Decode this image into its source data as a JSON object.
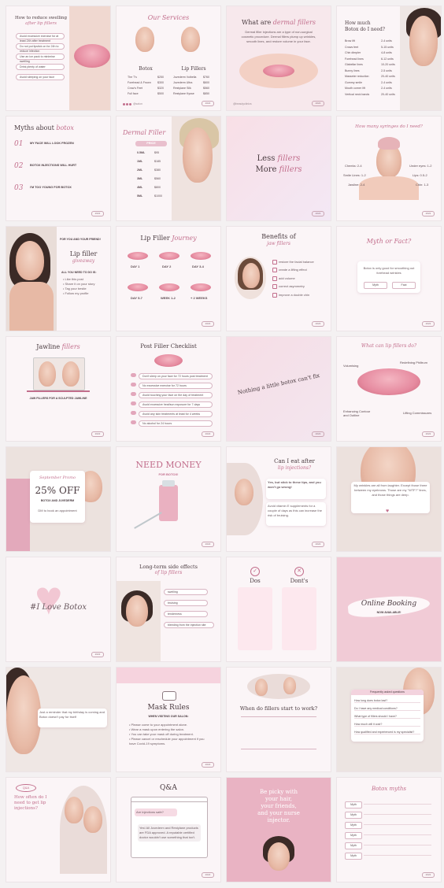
{
  "tiles": {
    "t1": {
      "title": "How to reduce swelling",
      "subtitle": "after lip fillers",
      "items": [
        "Avoid excessive exercise for at least 24h after treatment",
        "Do not put lipstick on for 24h to reduce infection",
        "Use an ice pack to minimise swelling",
        "Drink plenty of water",
        "Avoid sleeping on your face"
      ]
    },
    "t2": {
      "title": "Our Services",
      "col1": "Botox",
      "col2": "Lip Fillers",
      "rows1": [
        "The T's",
        "Forehead & Frown",
        "Crow's Feet",
        "Full face"
      ],
      "prices1": [
        "$250",
        "$300",
        "$320",
        "$500"
      ],
      "rows2": [
        "Juvederm Volbella",
        "Juvederm Ultra",
        "Restylane Silk",
        "Restylane Kysse"
      ],
      "prices2": [
        "$760",
        "$600",
        "$560",
        "$850"
      ]
    },
    "t3": {
      "title": "What are",
      "script": "dermal fillers",
      "body": "Dermal filler injections are a type of non-surgical cosmetic procedure. Dermal fillers plump up wrinkles, smooth lines, and restore volume in your face.",
      "handle": "@beautyclinics"
    },
    "t4": {
      "title": "How much",
      "title2": "Botox do I need?",
      "rows": [
        "Brow lift",
        "Crows feet",
        "Chin dimpler",
        "Forehead lines",
        "Glabellar lines",
        "Bunny lines",
        "Masseter reduction",
        "Gummy smile",
        "Mouth corner lift",
        "Vertical neck bands"
      ],
      "units": [
        "2-4 units",
        "5-15 units",
        "4-8 units",
        "6-12 units",
        "10-20 units",
        "2-5 units",
        "20-40 units",
        "2-4 units",
        "2-4 units",
        "20-40 units"
      ]
    },
    "t5": {
      "title": "Myths about",
      "script": "botox",
      "myths": [
        "MY FACE WILL LOOK FROZEN",
        "BOTOX INJECTIONS WILL HURT",
        "I'M TOO YOUNG FOR BOTOX"
      ],
      "nums": [
        "01",
        "02",
        "03"
      ]
    },
    "t6": {
      "title": "Dermal Filler",
      "price_label": "PRICE",
      "sizes": [
        "0.5ML",
        "1ML",
        "2ML",
        "3ML",
        "4ML",
        "5ML"
      ],
      "prices": [
        "$95",
        "$185",
        "$380",
        "$560",
        "$800",
        "$1000"
      ]
    },
    "t7": {
      "title": "Less",
      "script1": "fillers",
      "title2": "More",
      "script2": "fillers"
    },
    "t8": {
      "title": "How many syringes do I need?",
      "labels": [
        "Cheeks: 2-4",
        "Under eyes: 1-2",
        "Smile Lines: 1-2",
        "Lips: 0.5-2",
        "Jawline: 2-4",
        "Chin: 1-3"
      ]
    },
    "t9": {
      "tag": "FOR YOU AND YOUR FRIEND!",
      "title": "Lip filler",
      "script": "giveaway",
      "sub": "ALL YOU NEED TO DO IS:",
      "bullets": [
        "Like this post",
        "Share it on your story",
        "Tag your bestie",
        "Follow my profile"
      ]
    },
    "t10": {
      "title": "Lip Filler",
      "script": "Journey",
      "days": [
        "DAY 1",
        "DAY 2",
        "DAY 3-4",
        "DAY 5-7",
        "WEEK 1-2",
        "+ 2 WEEKS"
      ]
    },
    "t11": {
      "title": "Benefits of",
      "script": "jaw fillers",
      "items": [
        "restore the facial balance",
        "create a lifting effect",
        "add volume",
        "correct asymmetry",
        "improve a double chin"
      ]
    },
    "t12": {
      "title": "Myth or Fact?",
      "body": "Botox is only good for smoothing out forehead wrinkles",
      "btn1": "Myth",
      "btn2": "Fact"
    },
    "t13": {
      "title": "Jawline",
      "script": "fillers",
      "sub": "JAW FILLERS FOR A SCULPTED JAWLINE"
    },
    "t14": {
      "title": "Post Filler Checklist",
      "items": [
        "Don't sleep on your face for 72 hours post treatment",
        "No excessive exercise for 72 hours",
        "Avoid touching your face on the day of treatment",
        "Avoid excessive heat/sun exposure for 7 days",
        "Avoid any skin treatments at least for 4 weeks",
        "No alcohol for 24 hours"
      ]
    },
    "t15": {
      "text": "Nothing a little botox can't fix"
    },
    "t16": {
      "title": "What can lip fillers do?",
      "labels": [
        "Volumising",
        "Redefining Philtrum",
        "Enhancing Contour and Outline",
        "Lifting Commissures"
      ]
    },
    "t17": {
      "script": "September Promo",
      "big": "25% OFF",
      "sub": "BOTOX AND JUVEDERM",
      "note": "DM to book an appointment"
    },
    "t18": {
      "title": "NEED MONEY",
      "sub": "FOR BOTOX!"
    },
    "t19": {
      "title": "Can I eat after",
      "script": "lip injections?",
      "a1": "Yes, but stick to these tips, and you won't go wrong!",
      "a2": "Avoid vitamin E supplements for a couple of days as this can increase the risk of bruising."
    },
    "t20": {
      "body": "My wrinkles are all from laughter. Except those three between my eyebrows. Those are my \"WTF?\" lines, and those things are deep."
    },
    "t21": {
      "text": "#I Love Botox"
    },
    "t22": {
      "title": "Long-term side effects",
      "script": "of lip fillers",
      "items": [
        "swelling",
        "bruising",
        "tenderness",
        "bleeding from the injection site"
      ]
    },
    "t23": {
      "title1": "Dos",
      "title2": "Dont's"
    },
    "t24": {
      "script": "Online Booking",
      "sub": "NOW AVAILABLE!"
    },
    "t25": {
      "body": "Just a reminder that my birthday is coming and Botox doesn't pay for itself"
    },
    "t26": {
      "title": "Mask Rules",
      "sub": "WHEN VISITING OUR SALON:",
      "rules": [
        "Please come to your appointment alone.",
        "Wear a mask upon entering the salon.",
        "You can take your mask off during treatment.",
        "Please cancel or reschedule your appointment if you have Covid-19 symptoms."
      ]
    },
    "t27": {
      "title": "When do fillers start to work?"
    },
    "t28": {
      "title": "Frequently asked questions",
      "items": [
        "How long does botox last?",
        "Do I have any medical conditions?",
        "What type of fillers should I have?",
        "How much will it cost?",
        "How qualified and experienced is my specialist?"
      ]
    },
    "t29": {
      "badge": "Q&A",
      "title": "How often do I need to get lip injections?"
    },
    "t30": {
      "title": "Q&A",
      "q": "Are injections safe?",
      "a": "Yes! All Juvederm and Restylane products are FDA approved. A reputable certified doctor wouldn't use something that isn't."
    },
    "t31": {
      "line1": "Be picky with",
      "line2": "your hair,",
      "line3": "your friends,",
      "line4": "and your nurse",
      "line5": "injector."
    },
    "t32": {
      "title": "Botox myths",
      "tags": [
        "Myth",
        "Myth",
        "Myth",
        "Myth",
        "Myth",
        "Myth"
      ]
    }
  },
  "common": {
    "handle": "@salon",
    "year": "2022"
  },
  "colors": {
    "accent": "#c26e8c",
    "pink": "#f2d6df",
    "bg": "#fbf5f7",
    "text": "#4a3b40"
  }
}
